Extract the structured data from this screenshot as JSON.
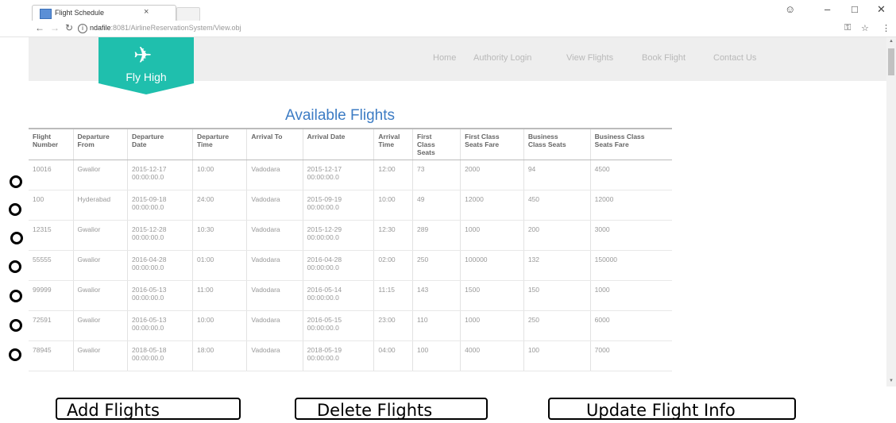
{
  "browser": {
    "tab_title": "Flight Schedule",
    "tab_close": "×",
    "url_host": "ndafile",
    "url_rest": ":8081/AirlineReservationSystem/View.obj"
  },
  "site": {
    "logo_text": "Fly High",
    "nav": [
      "Home",
      "Authority Login",
      "View Flights",
      "Book Flight",
      "Contact Us"
    ]
  },
  "heading": "Available Flights",
  "table": {
    "columns": [
      [
        "Flight",
        "Number"
      ],
      [
        "Departure",
        "From"
      ],
      [
        "Departure",
        "Date"
      ],
      [
        "Departure",
        "Time"
      ],
      [
        "Arrival To"
      ],
      [
        "Arrival Date"
      ],
      [
        "Arrival",
        "Time"
      ],
      [
        "First",
        "Class",
        "Seats"
      ],
      [
        "First Class",
        "Seats Fare"
      ],
      [
        "Business",
        "Class Seats"
      ],
      [
        "Business Class",
        "Seats Fare"
      ]
    ],
    "rows": [
      [
        "10016",
        "Gwalior",
        "2015-12-17\n00:00:00.0",
        "10:00",
        "Vadodara",
        "2015-12-17\n00:00:00.0",
        "12:00",
        "73",
        "2000",
        "94",
        "4500"
      ],
      [
        "100",
        "Hyderabad",
        "2015-09-18\n00:00:00.0",
        "24:00",
        "Vadodara",
        "2015-09-19\n00:00:00.0",
        "10:00",
        "49",
        "12000",
        "450",
        "12000"
      ],
      [
        "12315",
        "Gwalior",
        "2015-12-28\n00:00:00.0",
        "10:30",
        "Vadodara",
        "2015-12-29\n00:00:00.0",
        "12:30",
        "289",
        "1000",
        "200",
        "3000"
      ],
      [
        "55555",
        "Gwalior",
        "2016-04-28\n00:00:00.0",
        "01:00",
        "Vadodara",
        "2016-04-28\n00:00:00.0",
        "02:00",
        "250",
        "100000",
        "132",
        "150000"
      ],
      [
        "99999",
        "Gwalior",
        "2016-05-13\n00:00:00.0",
        "11:00",
        "Vadodara",
        "2016-05-14\n00:00:00.0",
        "11:15",
        "143",
        "1500",
        "150",
        "1000"
      ],
      [
        "72591",
        "Gwalior",
        "2016-05-13\n00:00:00.0",
        "10:00",
        "Vadodara",
        "2016-05-15\n00:00:00.0",
        "23:00",
        "110",
        "1000",
        "250",
        "6000"
      ],
      [
        "78945",
        "Gwalior",
        "2018-05-18\n00:00:00.0",
        "18:00",
        "Vadodara",
        "2018-05-19\n00:00:00.0",
        "04:00",
        "100",
        "4000",
        "100",
        "7000"
      ]
    ]
  },
  "actions": {
    "add": "Add Flights",
    "delete": "Delete Flights",
    "update": "Update Flight Info"
  },
  "colors": {
    "logo": "#1fbfad",
    "heading": "#3d7cc4",
    "nav_bg": "#eeeeee"
  },
  "icons": {
    "plane": "airplane-icon",
    "back": "back-arrow-icon",
    "forward": "forward-arrow-icon",
    "reload": "reload-icon",
    "info": "info-icon",
    "key": "key-icon",
    "star": "star-icon",
    "menu": "kebab-menu-icon"
  }
}
